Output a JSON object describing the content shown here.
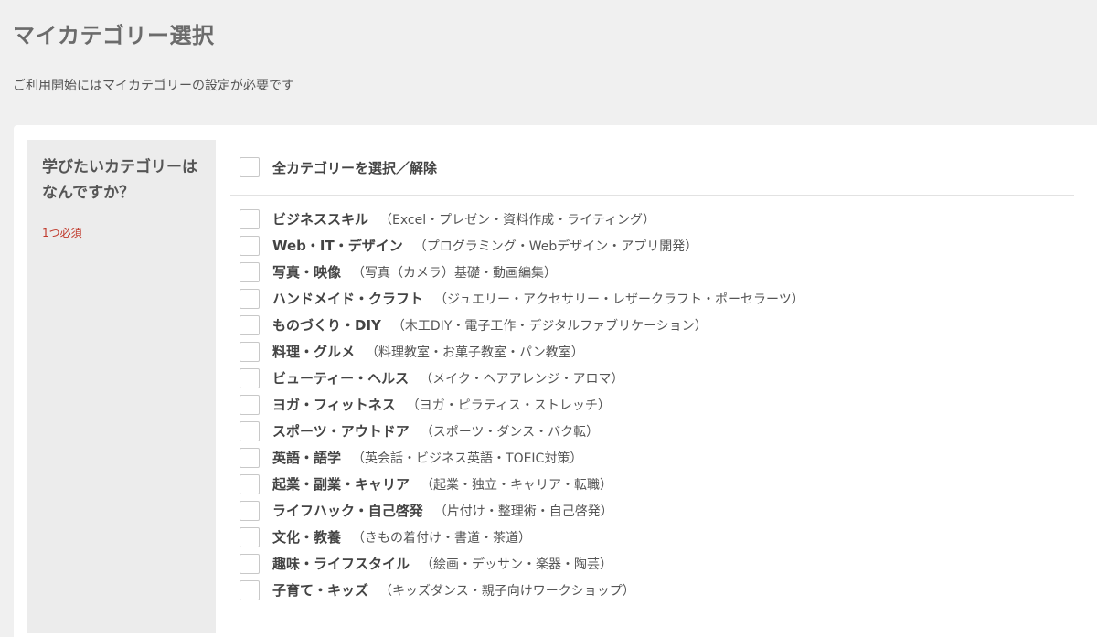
{
  "header": {
    "title": "マイカテゴリー選択",
    "subtitle": "ご利用開始にはマイカテゴリーの設定が必要です"
  },
  "question": {
    "text": "学びたいカテゴリーはなんですか？",
    "required": "1つ必須"
  },
  "select_all": {
    "label": "全カテゴリーを選択／解除",
    "checked": false
  },
  "categories": [
    {
      "name": "ビジネススキル",
      "detail": "（Excel・プレゼン・資料作成・ライティング）",
      "checked": false
    },
    {
      "name": "Web・IT・デザイン",
      "detail": "（プログラミング・Webデザイン・アプリ開発）",
      "checked": false
    },
    {
      "name": "写真・映像",
      "detail": "（写真（カメラ）基礎・動画編集）",
      "checked": false
    },
    {
      "name": "ハンドメイド・クラフト",
      "detail": "（ジュエリー・アクセサリー・レザークラフト・ポーセラーツ）",
      "checked": false
    },
    {
      "name": "ものづくり・DIY",
      "detail": "（木工DIY・電子工作・デジタルファブリケーション）",
      "checked": false
    },
    {
      "name": "料理・グルメ",
      "detail": "（料理教室・お菓子教室・パン教室）",
      "checked": false
    },
    {
      "name": "ビューティー・ヘルス",
      "detail": "（メイク・ヘアアレンジ・アロマ）",
      "checked": false
    },
    {
      "name": "ヨガ・フィットネス",
      "detail": "（ヨガ・ピラティス・ストレッチ）",
      "checked": false
    },
    {
      "name": "スポーツ・アウトドア",
      "detail": "（スポーツ・ダンス・バク転）",
      "checked": false
    },
    {
      "name": "英語・語学",
      "detail": "（英会話・ビジネス英語・TOEIC対策）",
      "checked": false
    },
    {
      "name": "起業・副業・キャリア",
      "detail": "（起業・独立・キャリア・転職）",
      "checked": false
    },
    {
      "name": "ライフハック・自己啓発",
      "detail": "（片付け・整理術・自己啓発）",
      "checked": false
    },
    {
      "name": "文化・教養",
      "detail": "（きもの着付け・書道・茶道）",
      "checked": false
    },
    {
      "name": "趣味・ライフスタイル",
      "detail": "（絵画・デッサン・楽器・陶芸）",
      "checked": false
    },
    {
      "name": "子育て・キッズ",
      "detail": "（キッズダンス・親子向けワークショップ）",
      "checked": false
    }
  ],
  "colors": {
    "page_background": "#f0f0f0",
    "panel_background": "#ffffff",
    "question_background": "#ececec",
    "required_text": "#c0392b",
    "checkbox_border": "#c8c8c8"
  }
}
